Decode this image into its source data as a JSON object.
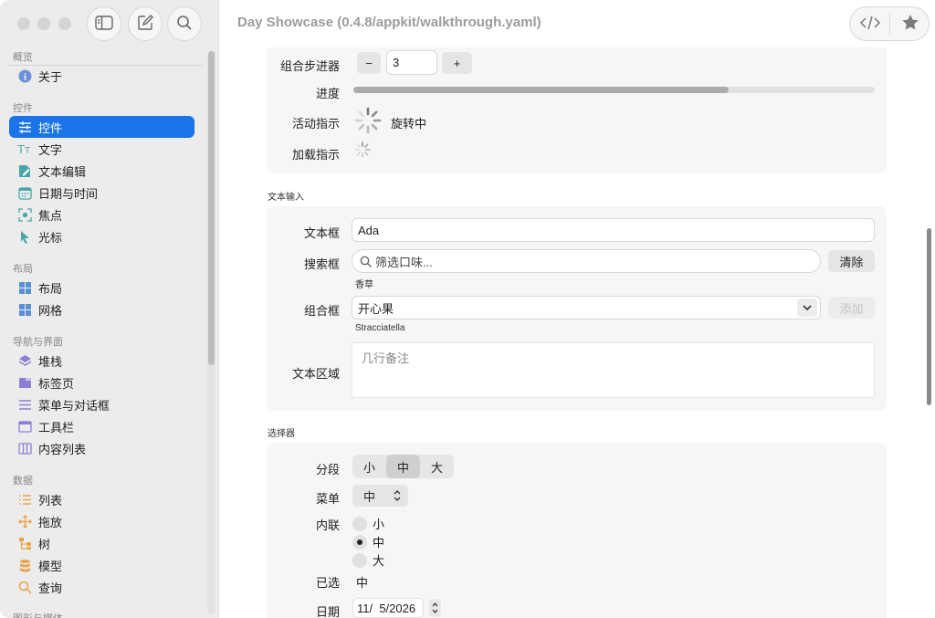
{
  "window": {
    "title": "Day Showcase (0.4.8/appkit/walkthrough.yaml)"
  },
  "toolbar": {
    "sidebar_toggle": "sidebar-toggle-icon",
    "compose": "compose-icon",
    "search": "search-icon",
    "code": "code-icon",
    "favorite": "star-icon"
  },
  "sidebar": {
    "partial_section": "概览",
    "about": "关于",
    "sections": {
      "controls": "控件",
      "layout": "布局",
      "navigation": "导航与界面",
      "data": "数据",
      "graphics_partial": "图形与媒体"
    },
    "items": {
      "controls": "控件",
      "text": "文字",
      "text_edit": "文本编辑",
      "date_time": "日期与时间",
      "focus": "焦点",
      "cursor": "光标",
      "layout": "布局",
      "grid": "网格",
      "stack": "堆栈",
      "tabs": "标签页",
      "menus_dialogs": "菜单与对话框",
      "toolbar": "工具栏",
      "content_list": "内容列表",
      "list": "列表",
      "drag_drop": "拖放",
      "tree": "树",
      "model": "模型",
      "query": "查询"
    },
    "accent": "#1a73e8"
  },
  "controls": {
    "stepper": {
      "label": "组合步进器",
      "minus": "−",
      "value": "3",
      "plus": "+"
    },
    "progress": {
      "label": "进度",
      "value": 0.72
    },
    "activity": {
      "label": "活动指示",
      "status": "旋转中"
    },
    "loading": {
      "label": "加载指示"
    }
  },
  "text_input": {
    "section_title": "文本输入",
    "textfield": {
      "label": "文本框",
      "value": "Ada"
    },
    "searchfield": {
      "label": "搜索框",
      "placeholder": "筛选口味...",
      "clear": "清除",
      "hint": "香草"
    },
    "combobox": {
      "label": "组合框",
      "value": "开心果",
      "add": "添加",
      "hint": "Stracciatella"
    },
    "textarea": {
      "label": "文本区域",
      "placeholder": "几行备注"
    }
  },
  "pickers": {
    "section_title": "选择器",
    "segment": {
      "label": "分段",
      "options": [
        "小",
        "中",
        "大"
      ],
      "selected": 1
    },
    "menu": {
      "label": "菜单",
      "value": "中"
    },
    "inline": {
      "label": "内联",
      "options": [
        "小",
        "中",
        "大"
      ],
      "selected": 1
    },
    "chosen": {
      "label": "已选",
      "value": "中"
    },
    "date": {
      "label": "日期",
      "value": "11/  5/2026"
    }
  }
}
